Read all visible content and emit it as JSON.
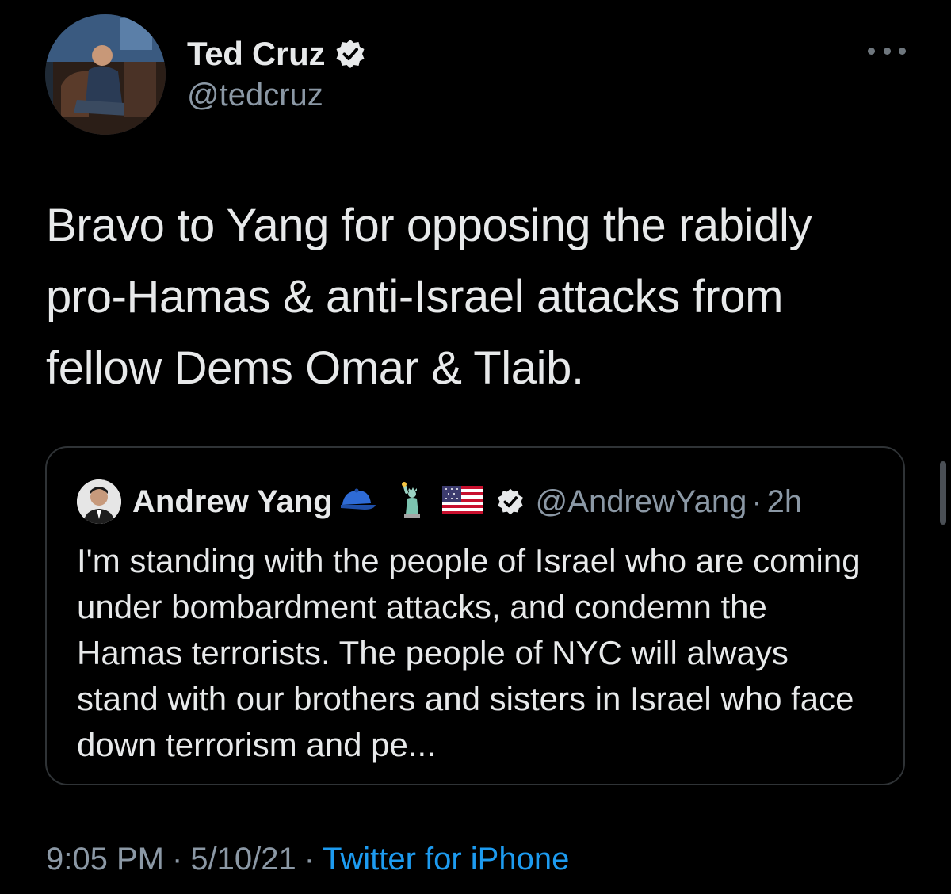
{
  "tweet": {
    "author": {
      "display_name": "Ted Cruz",
      "handle": "@tedcruz",
      "verified": true,
      "avatar_icon": "profile-photo"
    },
    "more_icon": "ellipsis-icon",
    "text": "Bravo to Yang for opposing the rabidly pro-Hamas & anti-Israel attacks from fellow Dems Omar & Tlaib.",
    "quoted_tweet": {
      "author": {
        "display_name": "Andrew Yang",
        "emojis": [
          "blue-cap-icon",
          "statue-of-liberty-icon",
          "us-flag-icon"
        ],
        "verified": true,
        "handle": "@AndrewYang",
        "separator": "·",
        "time": "2h"
      },
      "text": "I'm standing with the people of Israel who are coming under bombardment attacks, and condemn the Hamas terrorists. The people of NYC will always stand with our brothers and sisters in Israel who face down terrorism and pe..."
    },
    "meta": {
      "time": "9:05 PM",
      "sep1": "·",
      "date": "5/10/21",
      "sep2": "·",
      "source": "Twitter for iPhone"
    }
  },
  "colors": {
    "background": "#000000",
    "primary_text": "#e7e9ea",
    "secondary_text": "#8b98a5",
    "link": "#1d9bf0",
    "border": "#2f3336"
  }
}
